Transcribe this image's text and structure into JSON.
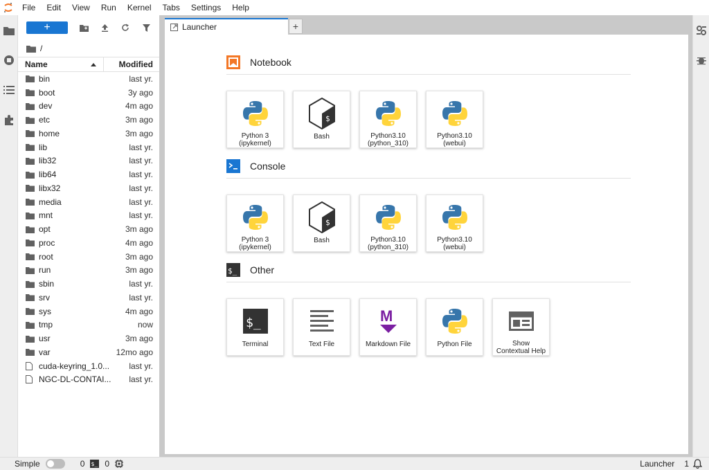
{
  "menubar": {
    "items": [
      "File",
      "Edit",
      "View",
      "Run",
      "Kernel",
      "Tabs",
      "Settings",
      "Help"
    ]
  },
  "left_bar": {
    "icons": [
      "folder-icon",
      "running-icon",
      "toc-icon",
      "extension-icon"
    ]
  },
  "file_browser": {
    "new_label": "+",
    "path": "/",
    "columns": {
      "name": "Name",
      "modified": "Modified"
    },
    "items": [
      {
        "name": "bin",
        "modified": "last yr.",
        "type": "folder"
      },
      {
        "name": "boot",
        "modified": "3y ago",
        "type": "folder"
      },
      {
        "name": "dev",
        "modified": "4m ago",
        "type": "folder"
      },
      {
        "name": "etc",
        "modified": "3m ago",
        "type": "folder"
      },
      {
        "name": "home",
        "modified": "3m ago",
        "type": "folder"
      },
      {
        "name": "lib",
        "modified": "last yr.",
        "type": "folder"
      },
      {
        "name": "lib32",
        "modified": "last yr.",
        "type": "folder"
      },
      {
        "name": "lib64",
        "modified": "last yr.",
        "type": "folder"
      },
      {
        "name": "libx32",
        "modified": "last yr.",
        "type": "folder"
      },
      {
        "name": "media",
        "modified": "last yr.",
        "type": "folder"
      },
      {
        "name": "mnt",
        "modified": "last yr.",
        "type": "folder"
      },
      {
        "name": "opt",
        "modified": "3m ago",
        "type": "folder"
      },
      {
        "name": "proc",
        "modified": "4m ago",
        "type": "folder"
      },
      {
        "name": "root",
        "modified": "3m ago",
        "type": "folder"
      },
      {
        "name": "run",
        "modified": "3m ago",
        "type": "folder"
      },
      {
        "name": "sbin",
        "modified": "last yr.",
        "type": "folder"
      },
      {
        "name": "srv",
        "modified": "last yr.",
        "type": "folder"
      },
      {
        "name": "sys",
        "modified": "4m ago",
        "type": "folder"
      },
      {
        "name": "tmp",
        "modified": "now",
        "type": "folder"
      },
      {
        "name": "usr",
        "modified": "3m ago",
        "type": "folder"
      },
      {
        "name": "var",
        "modified": "12mo ago",
        "type": "folder"
      },
      {
        "name": "cuda-keyring_1.0...",
        "modified": "last yr.",
        "type": "file"
      },
      {
        "name": "NGC-DL-CONTAI...",
        "modified": "last yr.",
        "type": "file"
      }
    ]
  },
  "tabs": [
    {
      "label": "Launcher"
    }
  ],
  "launcher": {
    "sections": [
      {
        "title": "Notebook",
        "icon": "notebook-icon",
        "cards": [
          {
            "label": "Python 3\n(ipykernel)",
            "icon": "python-icon"
          },
          {
            "label": "Bash",
            "icon": "bash-icon"
          },
          {
            "label": "Python3.10\n(python_310)",
            "icon": "python-icon"
          },
          {
            "label": "Python3.10\n(webui)",
            "icon": "python-icon"
          }
        ]
      },
      {
        "title": "Console",
        "icon": "console-icon",
        "cards": [
          {
            "label": "Python 3\n(ipykernel)",
            "icon": "python-icon"
          },
          {
            "label": "Bash",
            "icon": "bash-icon"
          },
          {
            "label": "Python3.10\n(python_310)",
            "icon": "python-icon"
          },
          {
            "label": "Python3.10\n(webui)",
            "icon": "python-icon"
          }
        ]
      },
      {
        "title": "Other",
        "icon": "terminal-section-icon",
        "cards": [
          {
            "label": "Terminal",
            "icon": "terminal-icon"
          },
          {
            "label": "Text File",
            "icon": "text-file-icon"
          },
          {
            "label": "Markdown File",
            "icon": "markdown-icon"
          },
          {
            "label": "Python File",
            "icon": "python-icon"
          },
          {
            "label": "Show\nContextual Help",
            "icon": "contextual-help-icon"
          }
        ]
      }
    ]
  },
  "statusbar": {
    "mode_label": "Simple",
    "kernels_count": "0",
    "terminals_count": "0",
    "activity_label": "Launcher",
    "notifications_count": "1"
  },
  "colors": {
    "accent": "#1976d2",
    "notebook": "#f37726",
    "console": "#1976d2",
    "markdown": "#7b1fa2",
    "python_blue": "#3776ab",
    "python_yellow": "#ffd43b"
  }
}
